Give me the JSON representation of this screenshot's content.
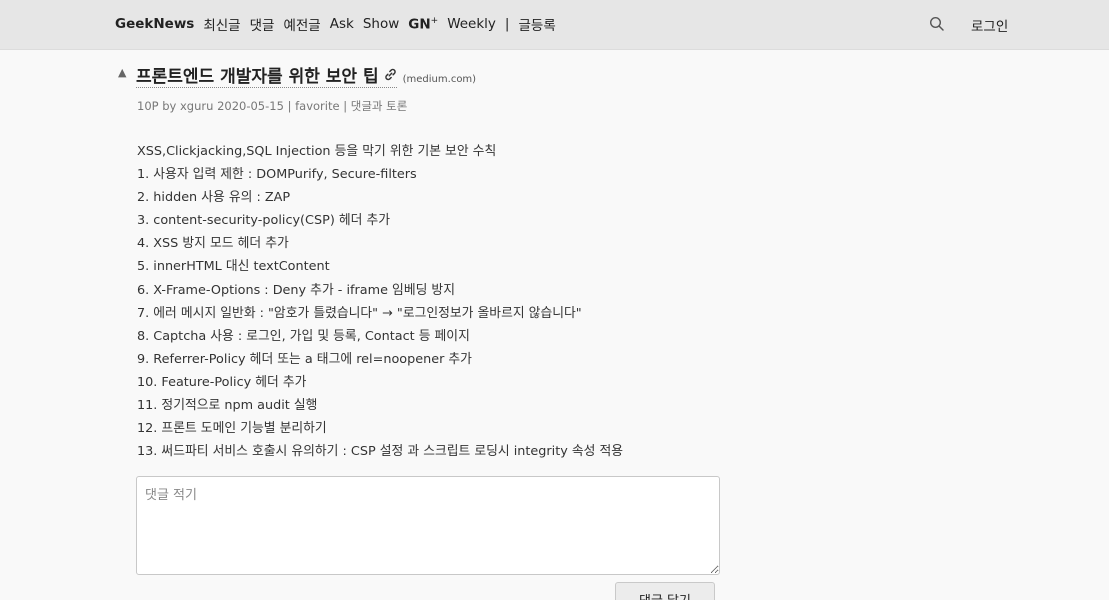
{
  "header": {
    "brand": "GeekNews",
    "nav": [
      "최신글",
      "댓글",
      "예전글",
      "Ask",
      "Show"
    ],
    "gn_label": "GN",
    "gn_sup": "+",
    "weekly": "Weekly",
    "separator": "|",
    "submit": "글등록",
    "login": "로그인"
  },
  "post": {
    "vote_arrow": "▲",
    "title": "프론트엔드 개발자를 위한 보안 팁",
    "domain": "(medium.com)",
    "meta": {
      "points": "10P",
      "by": "by",
      "author": "xguru",
      "date": "2020-05-15",
      "sep": "|",
      "favorite": "favorite",
      "discuss": "댓글과 토론"
    },
    "body_lines": [
      "XSS,Clickjacking,SQL Injection 등을 막기 위한 기본 보안 수칙",
      "1. 사용자 입력 제한 : DOMPurify, Secure-filters",
      "2. hidden 사용 유의 : ZAP",
      "3. content-security-policy(CSP) 헤더 추가",
      "4. XSS 방지 모드 헤더 추가",
      "5. innerHTML 대신 textContent",
      "6. X-Frame-Options : Deny 추가 - iframe 임베딩 방지",
      "7. 에러 메시지 일반화 : \"암호가 틀렸습니다\" → \"로그인정보가 올바르지 않습니다\"",
      "8. Captcha 사용 : 로그인, 가입 및 등록, Contact 등 페이지",
      "9. Referrer-Policy 헤더 또는 a 태그에 rel=noopener 추가",
      "10. Feature-Policy 헤더 추가",
      "11. 정기적으로 npm audit 실행",
      "12. 프론트 도메인 기능별 분리하기",
      "13. 써드파티 서비스 호출시 유의하기 : CSP 설정 과 스크립트 로딩시 integrity 속성 적용"
    ]
  },
  "comment": {
    "placeholder": "댓글 적기",
    "value": "",
    "submit_label": "댓글 달기"
  },
  "icons": {
    "search": "search-icon",
    "link": "link-icon"
  }
}
